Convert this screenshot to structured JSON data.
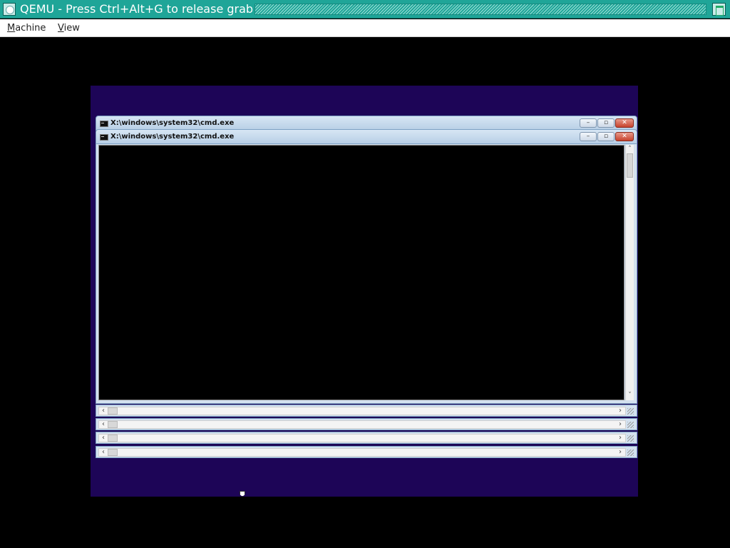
{
  "host_window": {
    "title": "QEMU - Press Ctrl+Alt+G to release grab",
    "accent_color": "#1fa598",
    "icons": {
      "close": "close-icon",
      "maximize": "maximize-icon"
    }
  },
  "menubar": {
    "items": [
      {
        "mnemonic": "M",
        "rest": "achine"
      },
      {
        "mnemonic": "V",
        "rest": "iew"
      }
    ]
  },
  "guest": {
    "desktop_color": "#1d0557",
    "windows": [
      {
        "title": "X:\\windows\\system32\\cmd.exe"
      },
      {
        "title": "X:\\windows\\system32\\cmd.exe"
      }
    ],
    "window_buttons": {
      "minimize": "–",
      "maximize": "▫",
      "close": "✕"
    },
    "scroll_arrows": {
      "up": "˄",
      "down": "˅",
      "left": "‹",
      "right": "›"
    }
  }
}
